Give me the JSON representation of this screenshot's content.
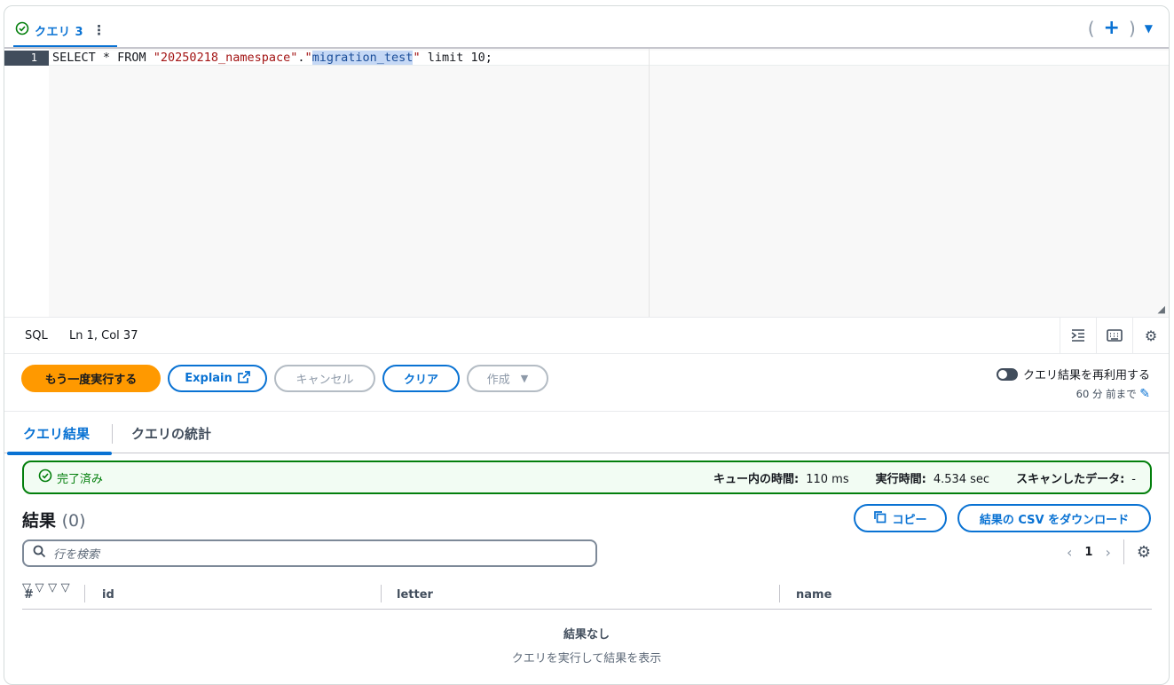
{
  "tab": {
    "label": "クエリ 3",
    "menu": "⋮",
    "open_paren": "(",
    "close_paren": ")",
    "add": "+",
    "caret": "▼"
  },
  "editor": {
    "line_number": "1",
    "code_keyword_select": "SELECT * FROM ",
    "code_schema": "\"20250218_namespace\"",
    "code_dot": ".",
    "code_table_open": "\"",
    "code_table": "migration_test",
    "code_table_close": "\"",
    "code_rest": " limit 10;"
  },
  "statusbar": {
    "language": "SQL",
    "cursor": "Ln 1, Col 37"
  },
  "actions": {
    "rerun": "もう一度実行する",
    "explain": "Explain",
    "cancel": "キャンセル",
    "clear": "クリア",
    "create": "作成"
  },
  "reuse": {
    "label": "クエリ結果を再利用する",
    "duration": "60 分 前まで"
  },
  "result_tabs": {
    "results": "クエリ結果",
    "stats": "クエリの統計"
  },
  "banner": {
    "status": "完了済み",
    "queue_label": "キュー内の時間:",
    "queue_value": "110 ms",
    "exec_label": "実行時間:",
    "exec_value": "4.534 sec",
    "scan_label": "スキャンしたデータ:",
    "scan_value": "-"
  },
  "results": {
    "title": "結果",
    "count": "(0)",
    "copy": "コピー",
    "download": "結果の CSV をダウンロード",
    "search_placeholder": "行を検索",
    "page": "1",
    "columns": [
      "#",
      "id",
      "letter",
      "name"
    ],
    "empty_title": "結果なし",
    "empty_hint": "クエリを実行して結果を表示"
  },
  "colors": {
    "accent": "#0972d3",
    "primary": "#ff9900",
    "success": "#037f0c"
  }
}
